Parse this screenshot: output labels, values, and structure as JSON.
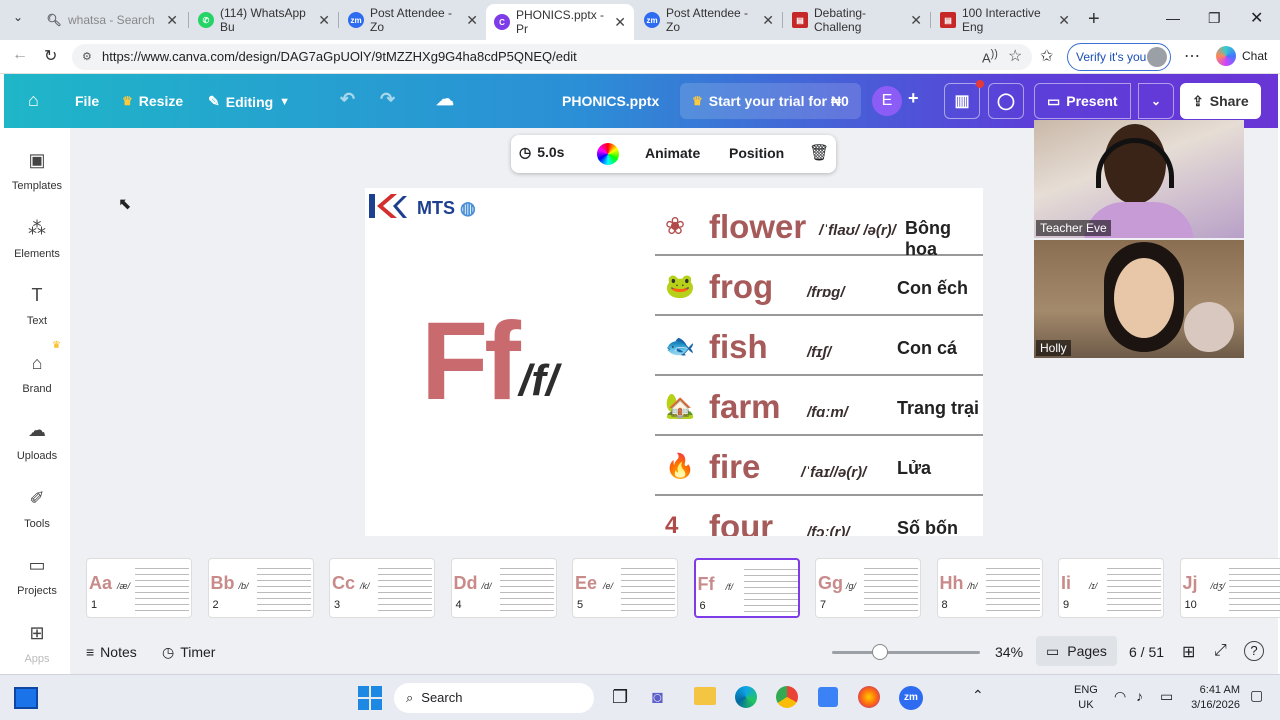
{
  "browser": {
    "tabs": [
      {
        "label": "whatsa - Search",
        "icon": "search-icon",
        "color": "#5f6368"
      },
      {
        "label": "(114) WhatsApp Bu",
        "icon": "whatsapp-icon",
        "color": "#25d366"
      },
      {
        "label": "Post Attendee - Zo",
        "icon": "zoom-icon",
        "color": "#2d6cf0"
      },
      {
        "label": "PHONICS.pptx - Pr",
        "icon": "canva-icon",
        "color": "#7d3ce8"
      },
      {
        "label": "Post Attendee - Zo",
        "icon": "zoom-icon",
        "color": "#2d6cf0"
      },
      {
        "label": "Debating-Challeng",
        "icon": "pdf-icon",
        "color": "#c62828"
      },
      {
        "label": "100 Interactive Eng",
        "icon": "pdf-icon",
        "color": "#c62828"
      }
    ],
    "url": "https://www.canva.com/design/DAG7aGpUOlY/9tMZZHXg9G4ha8cdP5QNEQ/edit",
    "verify_label": "Verify it's you",
    "chat_label": "Chat"
  },
  "header": {
    "file": "File",
    "resize": "Resize",
    "editing": "Editing",
    "doc_title": "PHONICS.pptx",
    "trial": "Start your trial for ₦0",
    "avatar_letter": "E",
    "present": "Present",
    "share": "Share"
  },
  "sidebar": [
    {
      "label": "Templates",
      "icon": "templates-icon"
    },
    {
      "label": "Elements",
      "icon": "elements-icon"
    },
    {
      "label": "Text",
      "icon": "text-icon"
    },
    {
      "label": "Brand",
      "icon": "brand-icon"
    },
    {
      "label": "Uploads",
      "icon": "uploads-icon"
    },
    {
      "label": "Tools",
      "icon": "tools-icon"
    },
    {
      "label": "Projects",
      "icon": "projects-icon"
    },
    {
      "label": "Apps",
      "icon": "apps-icon"
    }
  ],
  "toolbar": {
    "duration": "5.0s",
    "animate": "Animate",
    "position": "Position"
  },
  "slide": {
    "logo_mts": "MTS",
    "letter": "Ff",
    "phoneme": "/f/",
    "words": [
      {
        "word": "flower",
        "ipa": "/ˈflaʊ/ /ə(r)/",
        "meaning": "Bông hoa",
        "icon": "flower-icon",
        "glyph": "❀"
      },
      {
        "word": "frog",
        "ipa": "/frɒg/",
        "meaning": "Con ếch",
        "icon": "frog-icon",
        "glyph": "🐸"
      },
      {
        "word": "fish",
        "ipa": "/fɪʃ/",
        "meaning": "Con cá",
        "icon": "fish-icon",
        "glyph": "🐟"
      },
      {
        "word": "farm",
        "ipa": "/fɑːm/",
        "meaning": "Trang trại",
        "icon": "farm-icon",
        "glyph": "🏡"
      },
      {
        "word": "fire",
        "ipa": "/ˈfaɪ//ə(r)/",
        "meaning": "Lửa",
        "icon": "fire-icon",
        "glyph": "🔥"
      },
      {
        "word": "four",
        "ipa": "/fɔː(r)/",
        "meaning": "Số bốn",
        "icon": "four-icon",
        "glyph": "4"
      }
    ]
  },
  "pages": [
    {
      "num": "1",
      "big": "Aa",
      "ph": "/æ/"
    },
    {
      "num": "2",
      "big": "Bb",
      "ph": "/b/"
    },
    {
      "num": "3",
      "big": "Cc",
      "ph": "/k/"
    },
    {
      "num": "4",
      "big": "Dd",
      "ph": "/d/"
    },
    {
      "num": "5",
      "big": "Ee",
      "ph": "/e/"
    },
    {
      "num": "6",
      "big": "Ff",
      "ph": "/f/"
    },
    {
      "num": "7",
      "big": "Gg",
      "ph": "/g/"
    },
    {
      "num": "8",
      "big": "Hh",
      "ph": "/h/"
    },
    {
      "num": "9",
      "big": "Ii",
      "ph": "/ɪ/"
    },
    {
      "num": "10",
      "big": "Jj",
      "ph": "/dʒ/"
    }
  ],
  "footer": {
    "notes": "Notes",
    "timer": "Timer",
    "zoom": "34%",
    "pages": "Pages",
    "page_count": "6 / 51",
    "zoom_level": 0.34
  },
  "video": [
    {
      "name": "Teacher Eve"
    },
    {
      "name": "Holly"
    }
  ],
  "taskbar": {
    "search": "Search",
    "lang1": "ENG",
    "lang2": "UK",
    "time": "6:41 AM",
    "date": "3/16/2026"
  }
}
